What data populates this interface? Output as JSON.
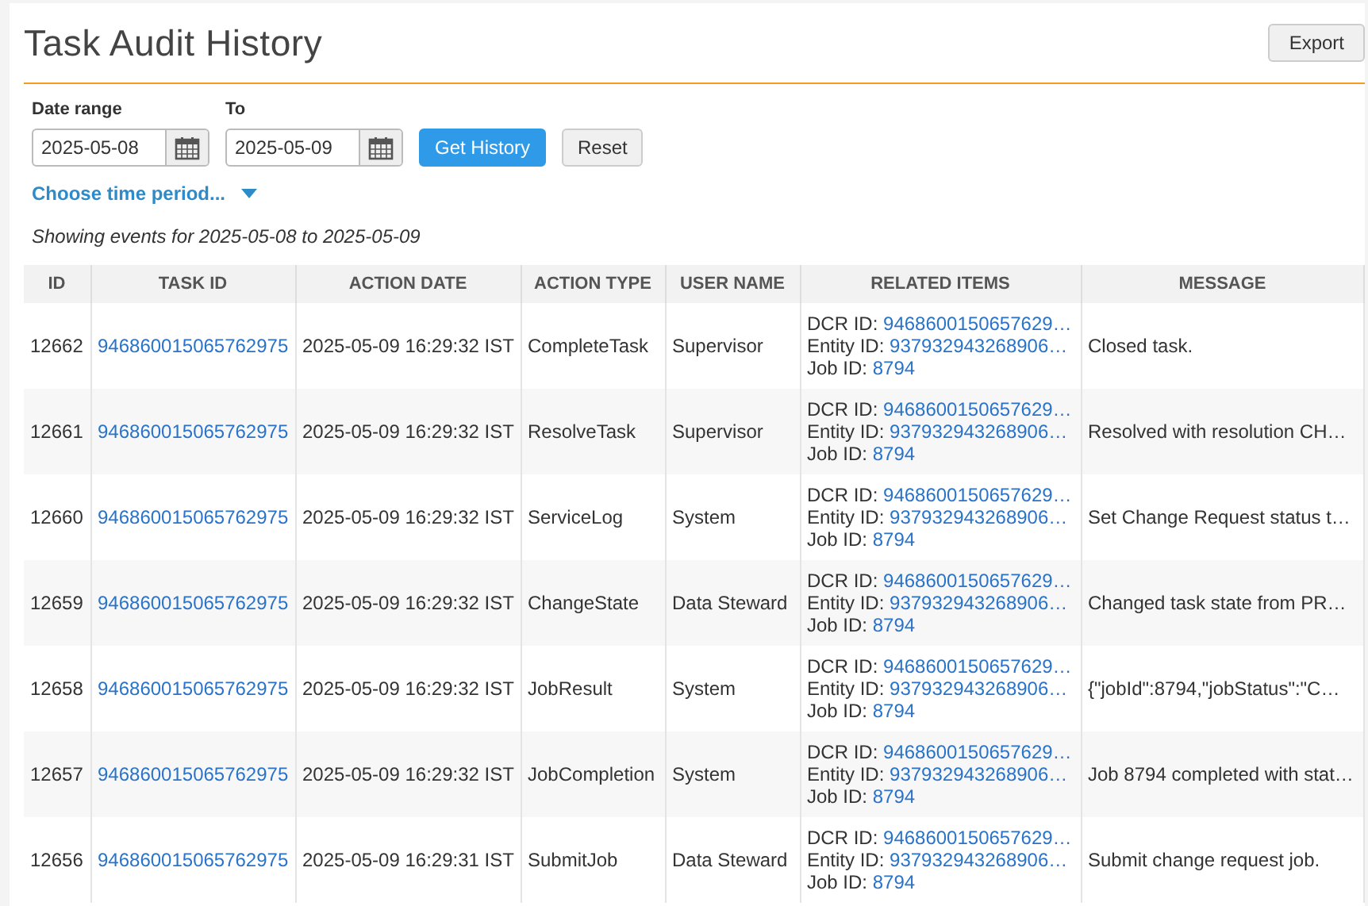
{
  "page": {
    "title": "Task Audit History",
    "export_button": "Export"
  },
  "filters": {
    "from_label": "Date range",
    "from_value": "2025-05-08",
    "to_label": "To",
    "to_value": "2025-05-09",
    "get_button": "Get History",
    "reset_button": "Reset",
    "period_dropdown": "Choose time period...",
    "summary": "Showing events for 2025-05-08 to 2025-05-09"
  },
  "table": {
    "columns": [
      "ID",
      "TASK ID",
      "ACTION DATE",
      "ACTION TYPE",
      "USER NAME",
      "RELATED ITEMS",
      "MESSAGE"
    ],
    "rows": [
      {
        "id": "12662",
        "task_id": "946860015065762975",
        "action_date": "2025-05-09 16:29:32 IST",
        "action_type": "CompleteTask",
        "user_name": "Supervisor",
        "related": [
          {
            "label": "DCR ID:",
            "value": "9468600150657629…"
          },
          {
            "label": "Entity ID:",
            "value": "937932943268906…"
          },
          {
            "label": "Job ID:",
            "value": "8794"
          }
        ],
        "message": "Closed task."
      },
      {
        "id": "12661",
        "task_id": "946860015065762975",
        "action_date": "2025-05-09 16:29:32 IST",
        "action_type": "ResolveTask",
        "user_name": "Supervisor",
        "related": [
          {
            "label": "DCR ID:",
            "value": "9468600150657629…"
          },
          {
            "label": "Entity ID:",
            "value": "937932943268906…"
          },
          {
            "label": "Job ID:",
            "value": "8794"
          }
        ],
        "message": "Resolved with resolution CH…"
      },
      {
        "id": "12660",
        "task_id": "946860015065762975",
        "action_date": "2025-05-09 16:29:32 IST",
        "action_type": "ServiceLog",
        "user_name": "System",
        "related": [
          {
            "label": "DCR ID:",
            "value": "9468600150657629…"
          },
          {
            "label": "Entity ID:",
            "value": "937932943268906…"
          },
          {
            "label": "Job ID:",
            "value": "8794"
          }
        ],
        "message": "Set Change Request status t…"
      },
      {
        "id": "12659",
        "task_id": "946860015065762975",
        "action_date": "2025-05-09 16:29:32 IST",
        "action_type": "ChangeState",
        "user_name": "Data Steward",
        "related": [
          {
            "label": "DCR ID:",
            "value": "9468600150657629…"
          },
          {
            "label": "Entity ID:",
            "value": "937932943268906…"
          },
          {
            "label": "Job ID:",
            "value": "8794"
          }
        ],
        "message": "Changed task state from PR…"
      },
      {
        "id": "12658",
        "task_id": "946860015065762975",
        "action_date": "2025-05-09 16:29:32 IST",
        "action_type": "JobResult",
        "user_name": "System",
        "related": [
          {
            "label": "DCR ID:",
            "value": "9468600150657629…"
          },
          {
            "label": "Entity ID:",
            "value": "937932943268906…"
          },
          {
            "label": "Job ID:",
            "value": "8794"
          }
        ],
        "message": "{\"jobId\":8794,\"jobStatus\":\"C…"
      },
      {
        "id": "12657",
        "task_id": "946860015065762975",
        "action_date": "2025-05-09 16:29:32 IST",
        "action_type": "JobCompletion",
        "user_name": "System",
        "related": [
          {
            "label": "DCR ID:",
            "value": "9468600150657629…"
          },
          {
            "label": "Entity ID:",
            "value": "937932943268906…"
          },
          {
            "label": "Job ID:",
            "value": "8794"
          }
        ],
        "message": "Job 8794 completed with stat…"
      },
      {
        "id": "12656",
        "task_id": "946860015065762975",
        "action_date": "2025-05-09 16:29:31 IST",
        "action_type": "SubmitJob",
        "user_name": "Data Steward",
        "related": [
          {
            "label": "DCR ID:",
            "value": "9468600150657629…"
          },
          {
            "label": "Entity ID:",
            "value": "937932943268906…"
          },
          {
            "label": "Job ID:",
            "value": "8794"
          }
        ],
        "message": "Submit change request job."
      }
    ]
  }
}
